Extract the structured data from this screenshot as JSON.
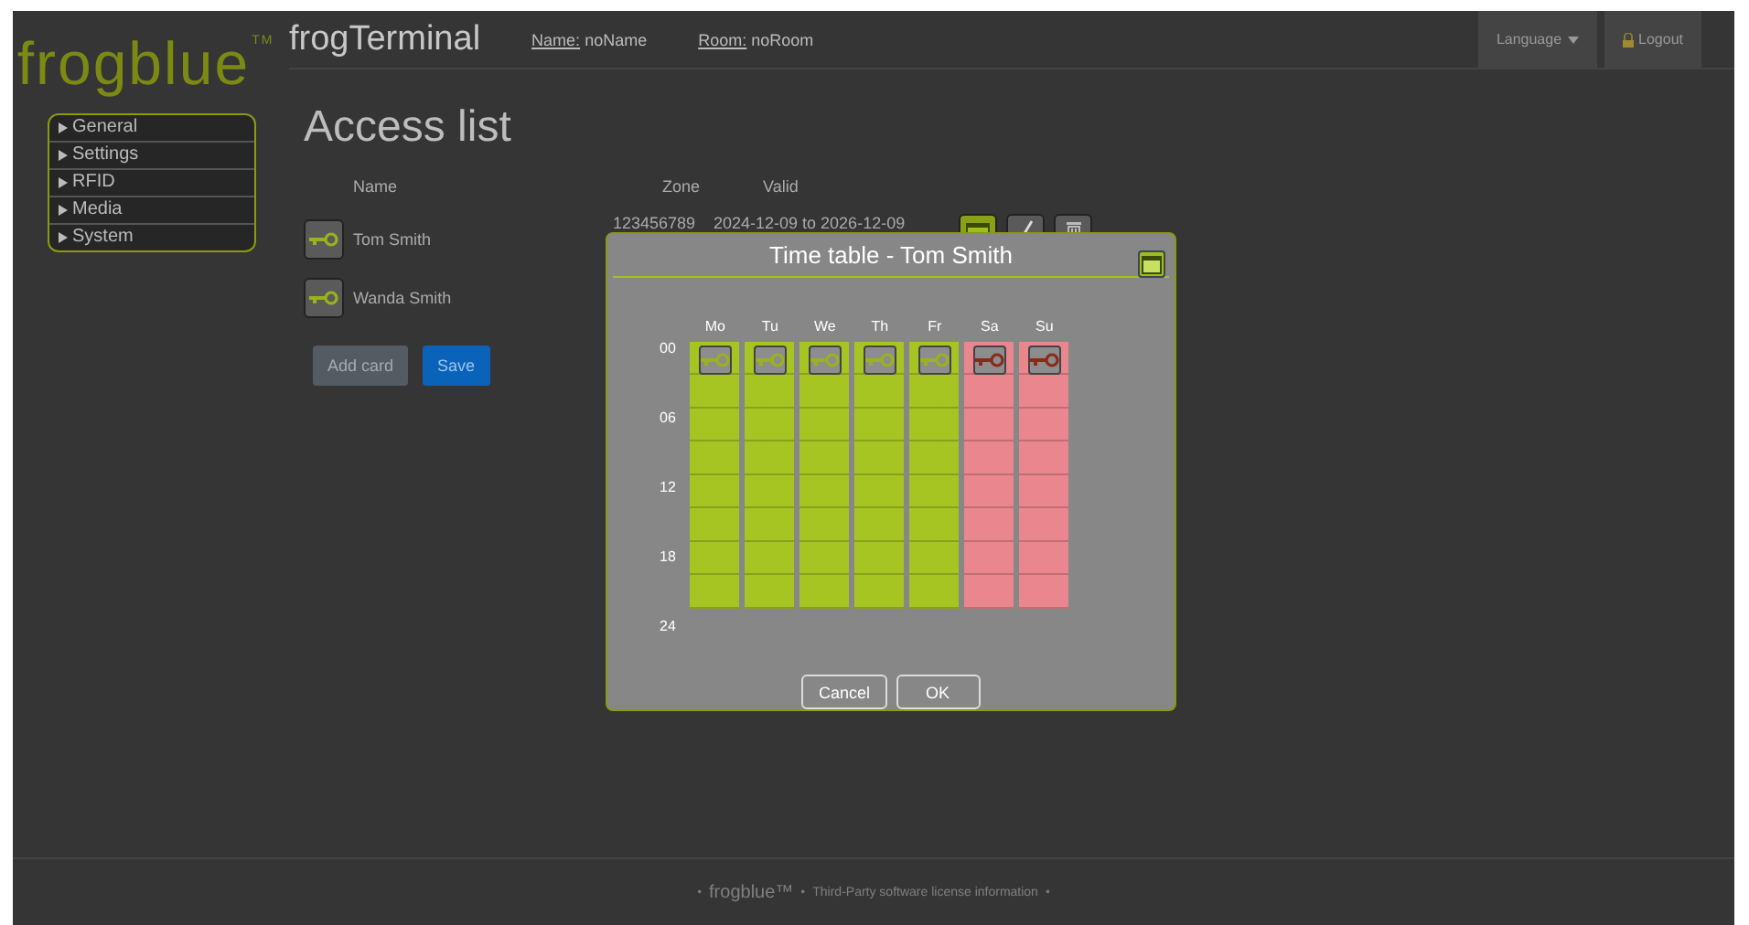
{
  "logo": {
    "text": "frogblue",
    "mark": "TM"
  },
  "sidebar": {
    "items": [
      {
        "label": "General",
        "expanded": false
      },
      {
        "label": "Settings",
        "expanded": false
      },
      {
        "label": "RFID",
        "expanded": false
      },
      {
        "label": "Media",
        "expanded": false
      },
      {
        "label": "System",
        "expanded": false
      }
    ]
  },
  "header": {
    "title": "frogTerminal",
    "fields": [
      {
        "label": "Name:",
        "value": "noName"
      },
      {
        "label": "Room:",
        "value": "noRoom"
      }
    ],
    "language": "Language",
    "logout": "Logout"
  },
  "page_title": "Access list",
  "table": {
    "columns": [
      "Name",
      "Zone",
      "Valid"
    ],
    "rows": [
      {
        "name": "Tom Smith",
        "zone": "123456789",
        "valid": "2024-12-09 to 2026-12-09",
        "actions": true
      },
      {
        "name": "Wanda Smith"
      }
    ]
  },
  "buttons": [
    {
      "label": "Add card",
      "kind": "secondary"
    },
    {
      "label": "Save",
      "kind": "primary"
    }
  ],
  "dialog": {
    "title": "Time table - Tom Smith",
    "hours": [
      "00",
      "06",
      "12",
      "18",
      "24"
    ],
    "days": [
      {
        "label": "Mo",
        "allowed": true
      },
      {
        "label": "Tu",
        "allowed": true
      },
      {
        "label": "We",
        "allowed": true
      },
      {
        "label": "Th",
        "allowed": true
      },
      {
        "label": "Fr",
        "allowed": true
      },
      {
        "label": "Sa",
        "allowed": false
      },
      {
        "label": "Su",
        "allowed": false
      }
    ],
    "buttons": [
      "Cancel",
      "OK"
    ]
  },
  "footer": {
    "separator": "•",
    "brand": "frogblue™",
    "link": "Third-Party software license information"
  }
}
